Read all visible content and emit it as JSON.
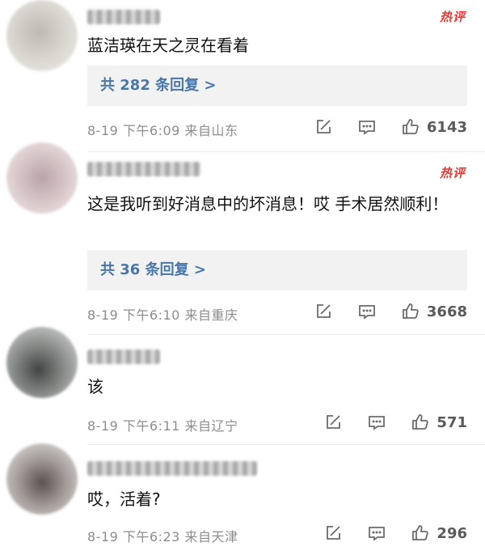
{
  "comments": [
    {
      "text": "蓝洁瑛在天之灵在看着",
      "hot_badge": "热评",
      "replies_label": "共 282 条回复 >",
      "date": "8-19",
      "time": "下午6:09",
      "location": "来自山东",
      "likes": "6143"
    },
    {
      "text": "这是我听到好消息中的坏消息！哎 手术居然顺利！",
      "hot_badge": "热评",
      "replies_label": "共 36 条回复 >",
      "date": "8-19",
      "time": "下午6:10",
      "location": "来自重庆",
      "likes": "3668"
    },
    {
      "text": "该",
      "date": "8-19",
      "time": "下午6:11",
      "location": "来自辽宁",
      "likes": "571"
    },
    {
      "text": "哎，活着?",
      "date": "8-19",
      "time": "下午6:23",
      "location": "来自天津",
      "likes": "296"
    }
  ],
  "icons": {
    "share": "share-icon",
    "comment": "comment-icon",
    "like": "thumbs-up-icon"
  },
  "colors": {
    "hot": "#e53935",
    "reply_link": "#4a77a8",
    "meta": "#8d8d8d"
  }
}
